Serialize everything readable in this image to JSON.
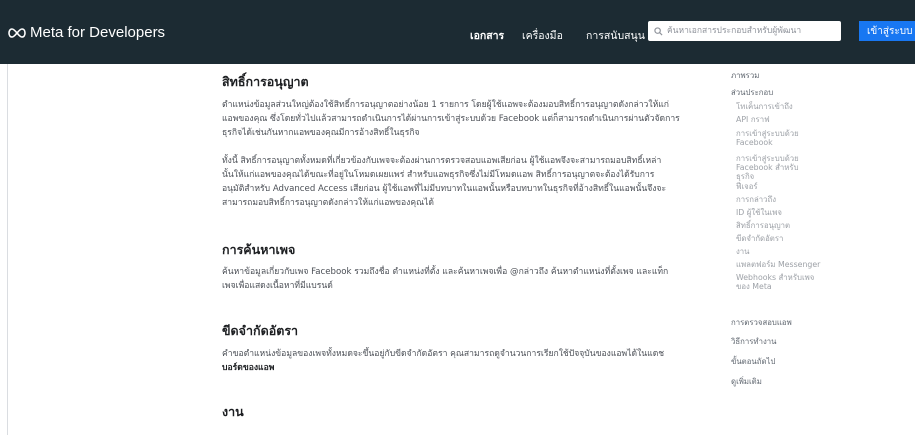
{
  "header": {
    "brand": "Meta for Developers",
    "nav": [
      {
        "label": "เอกสาร",
        "active": true
      },
      {
        "label": "เครื่องมือ",
        "active": false
      },
      {
        "label": "การสนับสนุน",
        "active": false
      }
    ],
    "search_placeholder": "ค้นหาเอกสารประกอบสำหรับผู้พัฒนา",
    "login_label": "เข้าสู่ระบบ",
    "colors": {
      "bar": "#1c2b33",
      "button": "#1877f2"
    }
  },
  "main": {
    "sections": [
      {
        "title": "สิทธิ์การอนุญาต",
        "paragraphs": [
          [
            "ตำแหน่งข้อมูลส่วนใหญ่ต้องใช้สิทธิ์การอนุญาตอย่างน้อย 1 รายการ โดยผู้ใช้แอพจะต้องมอบสิทธิ์การอนุญาตดังกล่าวให้แก่",
            "แอพของคุณ ซึ่งโดยทั่วไปแล้วสามารถดำเนินการได้ผ่านการเข้าสู่ระบบด้วย Facebook แต่ก็สามารถดำเนินการผ่านตัวจัดการ",
            "ธุรกิจได้เช่นกันหากแอพของคุณมีการอ้างสิทธิ์ในธุรกิจ"
          ],
          [
            "ทั้งนี้ สิทธิ์การอนุญาตทั้งหมดที่เกี่ยวข้องกับเพจจะต้องผ่านการตรวจสอบแอพเสียก่อน ผู้ใช้แอพจึงจะสามารถมอบสิทธิ์เหล่า",
            "นั้นให้แก่แอพของคุณได้ขณะที่อยู่ในโหมดเผยแพร่ สำหรับแอพธุรกิจซึ่งไม่มีโหมดแอพ สิทธิ์การอนุญาตจะต้องได้รับการ",
            "อนุมัติสำหรับ Advanced Access เสียก่อน ผู้ใช้แอพที่ไม่มีบทบาทในแอพนั้นหรือบทบาทในธุรกิจที่อ้างสิทธิ์ในแอพนั้นจึงจะ",
            "สามารถมอบสิทธิ์การอนุญาตดังกล่าวให้แก่แอพของคุณได้"
          ]
        ]
      },
      {
        "title": "การค้นหาเพจ",
        "paragraphs": [
          [
            "ค้นหาข้อมูลเกี่ยวกับเพจ Facebook รวมถึงชื่อ ตำแหน่งที่ตั้ง และค้นหาเพจเพื่อ @กล่าวถึง ค้นหาตำแหน่งที่ตั้งเพจ และแท็ก",
            "เพจเพื่อแสดงเนื้อหาที่มีแบรนด์"
          ]
        ]
      },
      {
        "title": "ขีดจำกัดอัตรา",
        "paragraphs": [
          [
            "คำขอตำแหน่งข้อมูลของเพจทั้งหมดจะขึ้นอยู่กับขีดจำกัดอัตรา คุณสามารถดูจำนวนการเรียกใช้ปัจจุบันของแอพได้ในแดช",
            "บอร์ดของแอพ"
          ]
        ],
        "bold_fragments": [
          "แดช",
          "บอร์ดของแอพ"
        ]
      },
      {
        "title": "งาน",
        "paragraphs": []
      }
    ]
  },
  "sidebar": {
    "items": [
      {
        "label": "ภาพรวม",
        "level": 0
      },
      {
        "label": "ส่วนประกอบ",
        "level": 0
      },
      {
        "label": "โทเค็นการเข้าถึง",
        "level": 1
      },
      {
        "label": "API กราฟ",
        "level": 1
      },
      {
        "label": "การเข้าสู่ระบบด้วย Facebook",
        "level": 1
      },
      {
        "label": "การเข้าสู่ระบบด้วย Facebook สำหรับธุรกิจ",
        "level": 1
      },
      {
        "label": "ฟีเจอร์",
        "level": 1
      },
      {
        "label": "การกล่าวถึง",
        "level": 1
      },
      {
        "label": "ID ผู้ใช้ในเพจ",
        "level": 1
      },
      {
        "label": "สิทธิ์การอนุญาต",
        "level": 1
      },
      {
        "label": "ขีดจำกัดอัตรา",
        "level": 1
      },
      {
        "label": "งาน",
        "level": 1
      },
      {
        "label": "แพลตฟอร์ม Messenger",
        "level": 1
      },
      {
        "label": "Webhooks สำหรับเพจของ Meta",
        "level": 1
      },
      {
        "label": "การตรวจสอบแอพ",
        "level": 0
      },
      {
        "label": "วิธีการทำงาน",
        "level": 0
      },
      {
        "label": "ขั้นตอนถัดไป",
        "level": 0
      },
      {
        "label": "ดูเพิ่มเติม",
        "level": 0
      }
    ]
  }
}
